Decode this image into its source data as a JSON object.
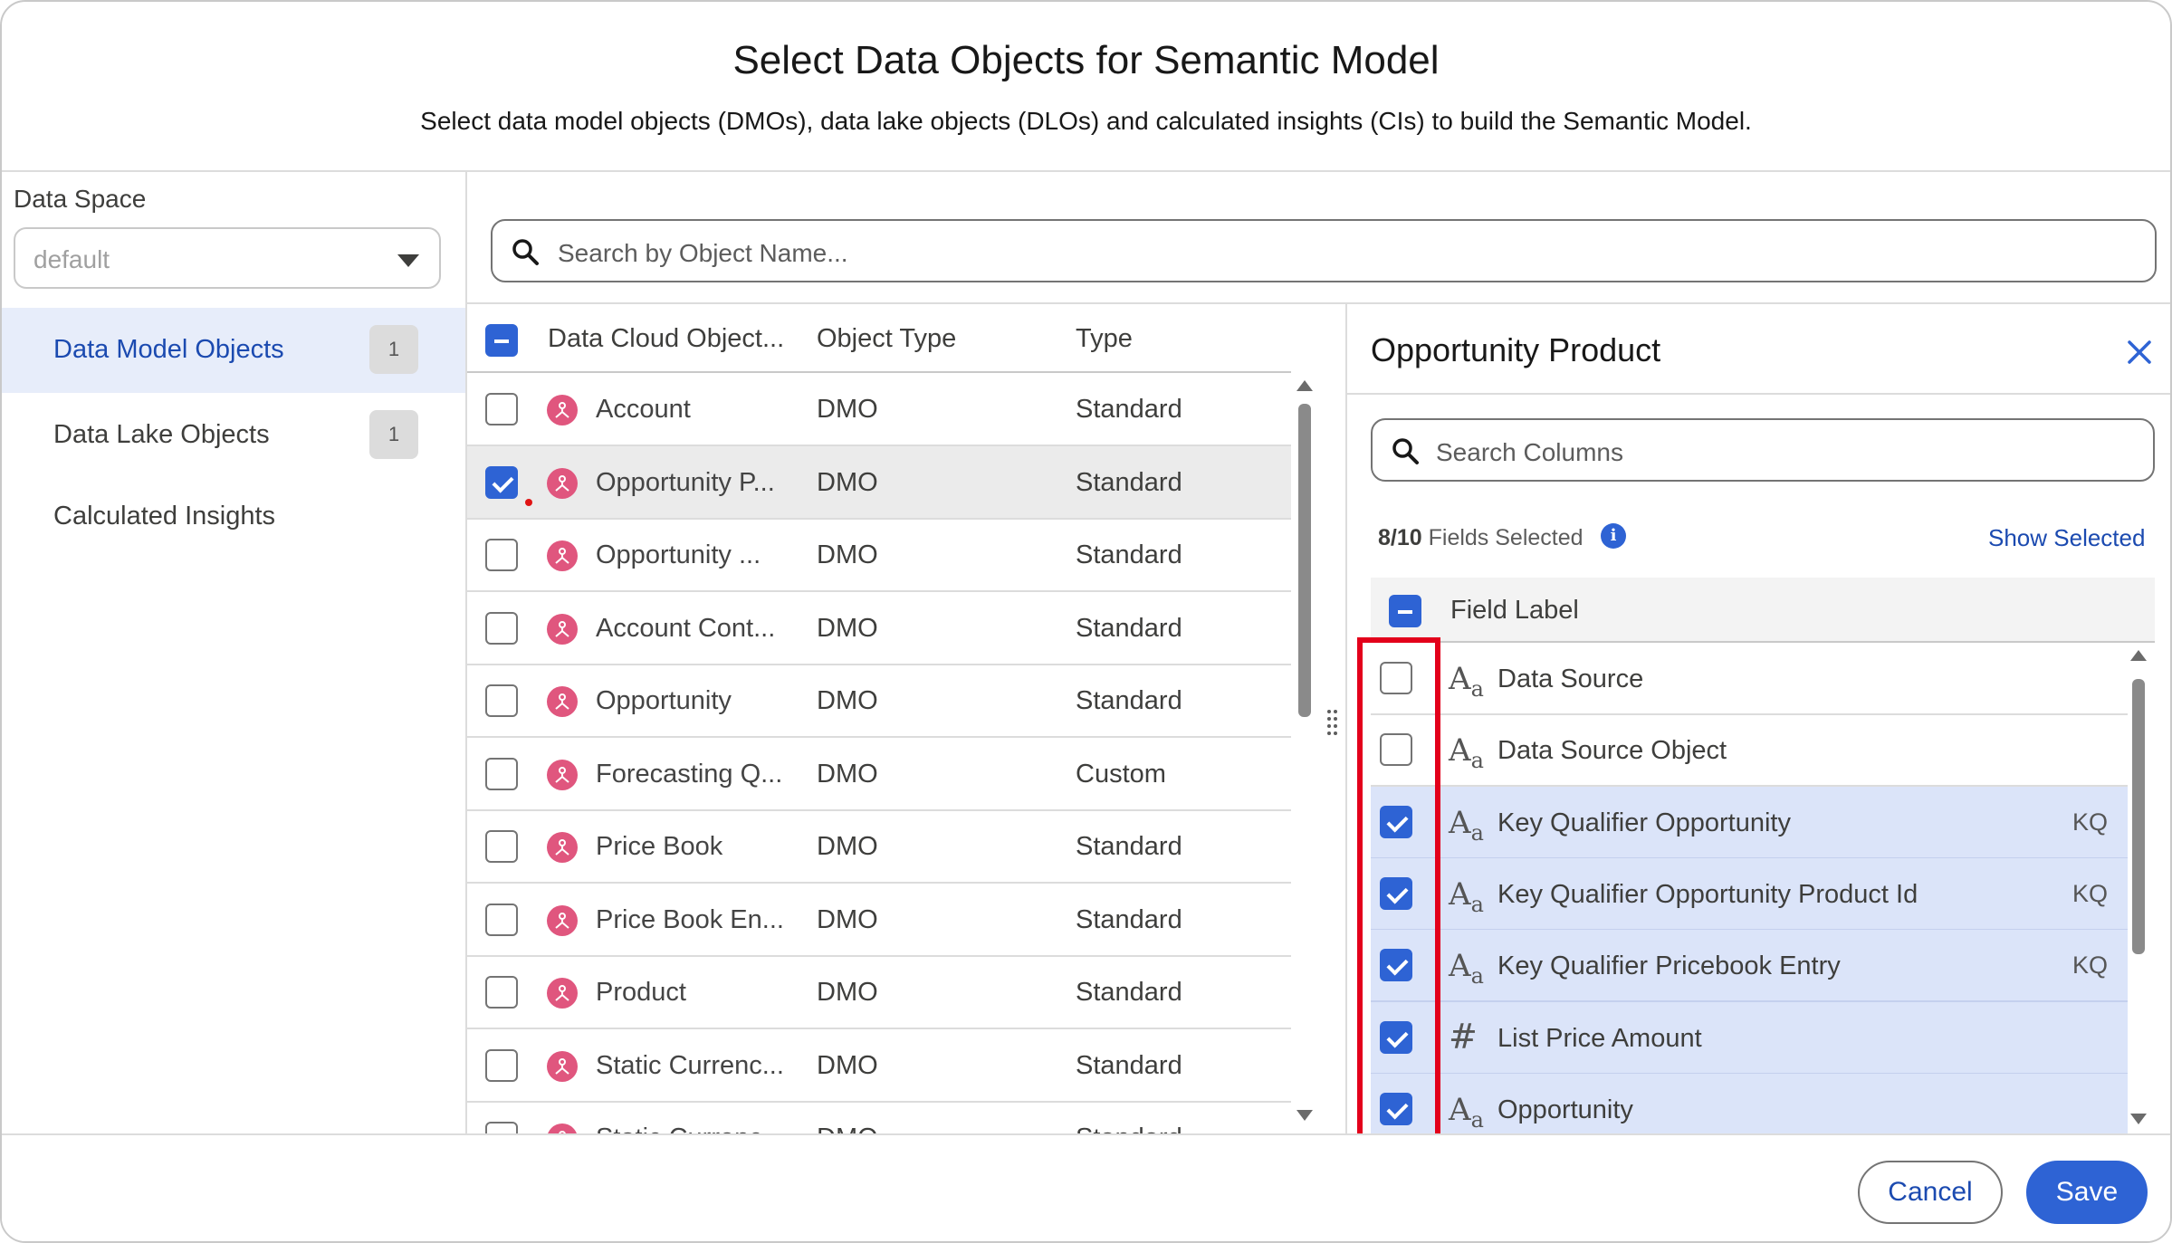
{
  "dialog": {
    "title": "Select Data Objects for Semantic Model",
    "subtitle": "Select data model objects (DMOs), data lake objects (DLOs) and calculated insights (CIs) to build the Semantic Model."
  },
  "sidebar": {
    "data_space_label": "Data Space",
    "data_space_value": "default",
    "items": [
      {
        "label": "Data Model Objects",
        "count": "1",
        "active": true
      },
      {
        "label": "Data Lake Objects",
        "count": "1",
        "active": false
      },
      {
        "label": "Calculated Insights",
        "count": "",
        "active": false
      }
    ]
  },
  "search": {
    "placeholder": "Search by Object Name..."
  },
  "table": {
    "columns": [
      "Data Cloud Object...",
      "Object Type",
      "Type"
    ],
    "rows": [
      {
        "name": "Account",
        "object_type": "DMO",
        "type": "Standard",
        "checked": false
      },
      {
        "name": "Opportunity P...",
        "object_type": "DMO",
        "type": "Standard",
        "checked": true
      },
      {
        "name": "Opportunity ...",
        "object_type": "DMO",
        "type": "Standard",
        "checked": false
      },
      {
        "name": "Account Cont...",
        "object_type": "DMO",
        "type": "Standard",
        "checked": false
      },
      {
        "name": "Opportunity",
        "object_type": "DMO",
        "type": "Standard",
        "checked": false
      },
      {
        "name": "Forecasting Q...",
        "object_type": "DMO",
        "type": "Custom",
        "checked": false
      },
      {
        "name": "Price Book",
        "object_type": "DMO",
        "type": "Standard",
        "checked": false
      },
      {
        "name": "Price Book En...",
        "object_type": "DMO",
        "type": "Standard",
        "checked": false
      },
      {
        "name": "Product",
        "object_type": "DMO",
        "type": "Standard",
        "checked": false
      },
      {
        "name": "Static Currenc...",
        "object_type": "DMO",
        "type": "Standard",
        "checked": false
      },
      {
        "name": "Static Currenc...",
        "object_type": "DMO",
        "type": "Standard",
        "checked": false
      }
    ]
  },
  "panel": {
    "title": "Opportunity Product",
    "search_placeholder": "Search Columns",
    "fields_selected_count": "8/10",
    "fields_selected_text": "Fields Selected",
    "show_selected": "Show Selected",
    "column_header": "Field Label",
    "fields": [
      {
        "type_icon": "text-type-icon",
        "label": "Data Source",
        "badge": "",
        "checked": false
      },
      {
        "type_icon": "text-type-icon",
        "label": "Data Source Object",
        "badge": "",
        "checked": false
      },
      {
        "type_icon": "text-type-icon",
        "label": "Key Qualifier Opportunity",
        "badge": "KQ",
        "checked": true
      },
      {
        "type_icon": "text-type-icon",
        "label": "Key Qualifier Opportunity Product Id",
        "badge": "KQ",
        "checked": true
      },
      {
        "type_icon": "text-type-icon",
        "label": "Key Qualifier Pricebook Entry",
        "badge": "KQ",
        "checked": true
      },
      {
        "type_icon": "number-type-icon",
        "label": "List Price Amount",
        "badge": "",
        "checked": true
      },
      {
        "type_icon": "text-type-icon",
        "label": "Opportunity",
        "badge": "",
        "checked": true
      }
    ]
  },
  "footer": {
    "cancel_label": "Cancel",
    "save_label": "Save"
  },
  "colors": {
    "accent": "#2e63d4",
    "highlight_box": "#e3001b",
    "object_icon": "#e0567e"
  }
}
